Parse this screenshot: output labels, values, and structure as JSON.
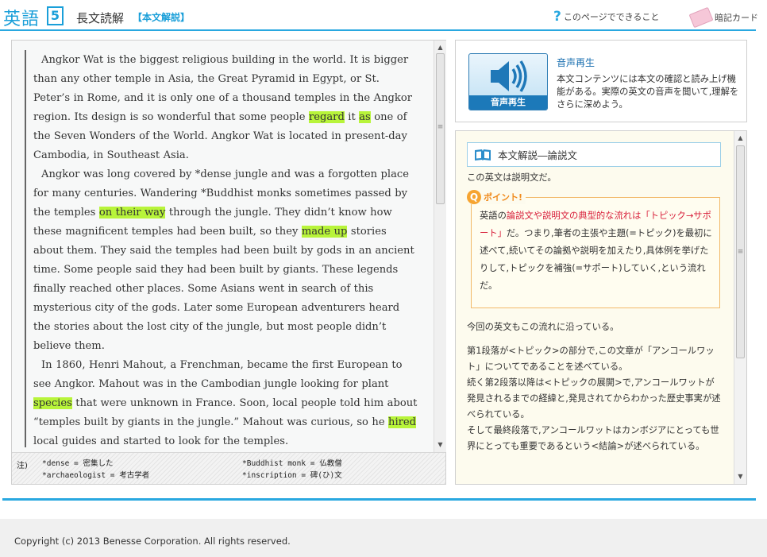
{
  "header": {
    "subject": "英語",
    "unit": "5",
    "section_title": "長文読解",
    "section_sub": "【本文解説】",
    "help_label": "このページでできること",
    "card_label": "暗記カード"
  },
  "passage": {
    "paragraphs": [
      [
        {
          "t": "Angkor Wat is the biggest religious building in the world. It is bigger than any other temple in Asia, the Great Pyramid in Egypt, or St. Peter’s in Rome, and it is only one of a thousand temples in the Angkor region. Its design is so wonderful that some people "
        },
        {
          "t": "regard",
          "hl": true
        },
        {
          "t": " it "
        },
        {
          "t": "as",
          "hl": true
        },
        {
          "t": " one of the Seven Wonders of the World. Angkor Wat is located in present-day Cambodia, in Southeast Asia."
        }
      ],
      [
        {
          "t": "Angkor was long covered by *dense jungle and was a forgotten place for many centuries. Wandering *Buddhist monks sometimes passed by the temples "
        },
        {
          "t": "on their way",
          "hl": true
        },
        {
          "t": " through the jungle. They didn’t know how these magnificent temples had been built, so they "
        },
        {
          "t": "made up",
          "hl": true
        },
        {
          "t": " stories about them. They said the temples had been built by gods in an ancient time. Some people said they had been built by giants. These legends finally reached other places. Some Asians went in search of this mysterious city of the gods. Later some European adventurers heard the stories about the lost city of the jungle, but most people didn’t believe them."
        }
      ],
      [
        {
          "t": "In 1860, Henri Mahout, a Frenchman, became the first European to see Angkor. Mahout was in the Cambodian jungle looking for plant "
        },
        {
          "t": "species",
          "hl": true
        },
        {
          "t": " that were unknown in France. Soon, local people told him about “temples built by giants in the jungle.” Mahout was curious, so he "
        },
        {
          "t": "hired",
          "hl": true
        },
        {
          "t": " local guides and started to look for the temples."
        }
      ]
    ]
  },
  "notes": {
    "label": "注)",
    "items": [
      "*dense = 密集した",
      "*Buddhist monk = 仏教僧",
      "*archaeologist = 考古学者",
      "*inscription = 碑(ひ)文"
    ]
  },
  "audio": {
    "button_label": "音声再生",
    "title": "音声再生",
    "description": "本文コンテンツには本文の確認と読み上げ機能がある。実際の英文の音声を聞いて,理解をさらに深めよう。"
  },
  "commentary": {
    "heading": "本文解説―論説文",
    "intro": "この英文は説明文だ。",
    "point_label": "ポイント!",
    "point_pre": "英語の",
    "point_red": "論説文や説明文の典型的な流れは「トピック→サポート」",
    "point_post": "だ。つまり,筆者の主張や主題(=トピック)を最初に述べて,続いてその論拠や説明を加えたり,具体例を挙げたりして,トピックを補強(=サポート)していく,という流れだ。",
    "para1": "今回の英文もこの流れに沿っている。",
    "para2": "第1段落が<トピック>の部分で,この文章が「アンコールワット」についてであることを述べている。",
    "para3": "続く第2段落以降は<トピックの展開>で,アンコールワットが発見されるまでの経緯と,発見されてからわかった歴史事実が述べられている。",
    "para4": "そして最終段落で,アンコールワットはカンボジアにとっても世界にとっても重要であるという<結論>が述べられている。"
  },
  "footer": {
    "copyright": "Copyright (c) 2013 Benesse Corporation. All rights reserved."
  },
  "colors": {
    "accent": "#29a8e0",
    "highlight": "#b8f43a",
    "point_red": "#d8203b",
    "point_orange": "#f08a1c"
  }
}
